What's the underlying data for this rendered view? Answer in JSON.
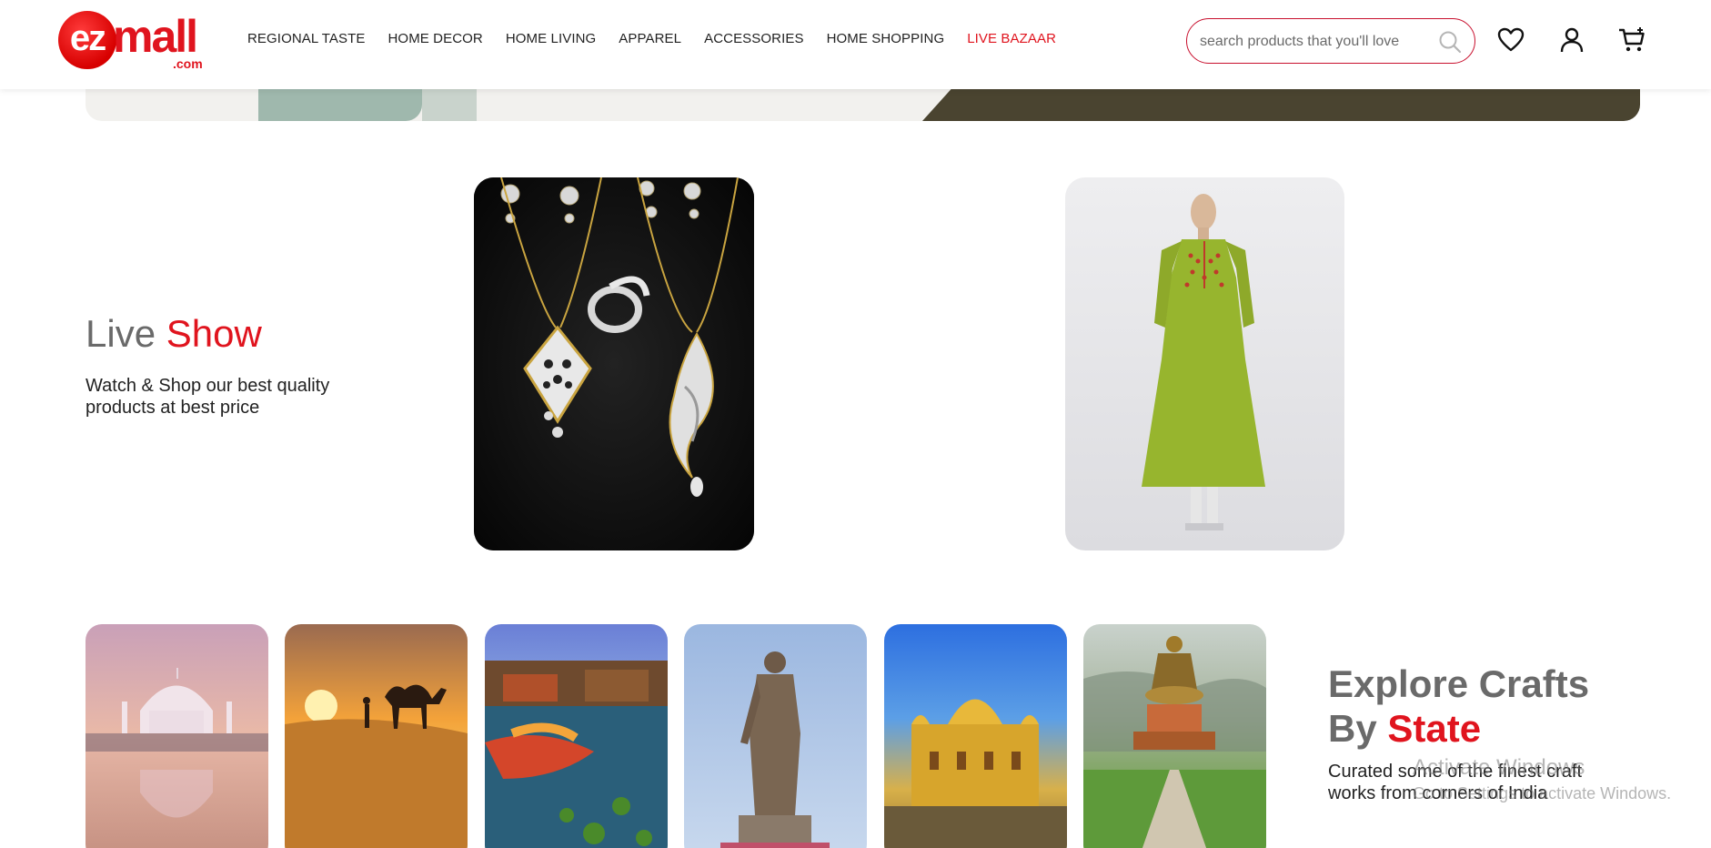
{
  "header": {
    "logo": {
      "main": "ez",
      "mall": "mall",
      "tld": ".com"
    },
    "nav": [
      {
        "label": "REGIONAL TASTE"
      },
      {
        "label": "HOME DECOR"
      },
      {
        "label": "HOME LIVING"
      },
      {
        "label": "APPAREL"
      },
      {
        "label": "ACCESSORIES"
      },
      {
        "label": "HOME SHOPPING"
      },
      {
        "label": "LIVE BAZAAR"
      }
    ],
    "search": {
      "placeholder": "search products that you'll love",
      "value": ""
    },
    "icons": [
      "search-icon",
      "heart-icon",
      "user-icon",
      "cart-icon"
    ]
  },
  "live_show": {
    "title_plain": "Live",
    "title_accent": "Show",
    "subtitle": "Watch & Shop our best quality products at best price",
    "cards": [
      {
        "image": "jewellery-pendants-image"
      },
      {
        "image": "green-kurta-image"
      }
    ]
  },
  "explore": {
    "title_line1": "Explore Crafts",
    "title_plain": "By",
    "title_accent": "State",
    "subtitle": "Curated some of the finest craft works from corners of India",
    "states": [
      {
        "image": "taj-mahal-image"
      },
      {
        "image": "desert-camel-image"
      },
      {
        "image": "dal-lake-shikara-image"
      },
      {
        "image": "statue-of-unity-image"
      },
      {
        "image": "golden-temple-image"
      },
      {
        "image": "buddha-statue-image"
      }
    ]
  },
  "watermark": {
    "line1": "Activate Windows",
    "line2": "Go to Settings to activate Windows."
  },
  "colors": {
    "accent": "#e0141e",
    "text": "#222222",
    "muted": "#6a6a6a"
  }
}
